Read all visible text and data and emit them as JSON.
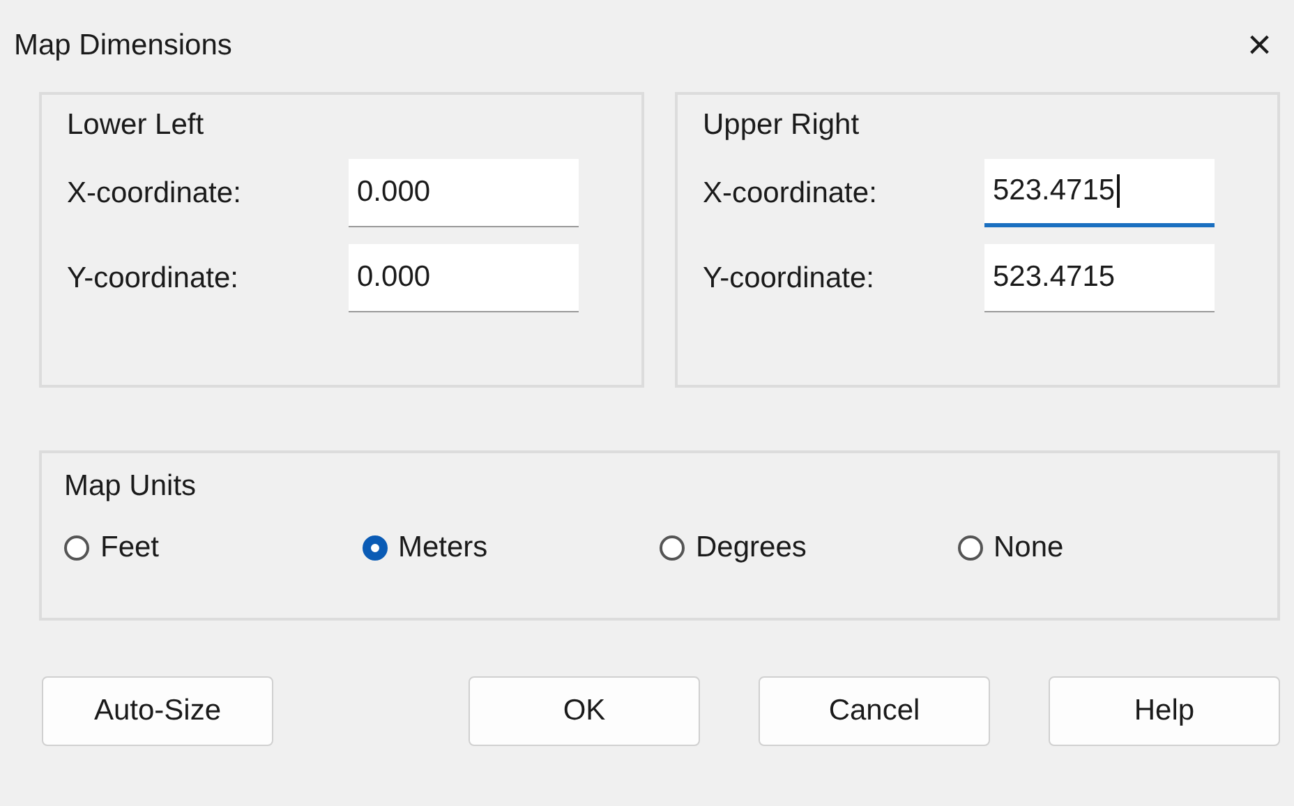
{
  "window": {
    "title": "Map Dimensions",
    "close": "×"
  },
  "groups": [
    {
      "title": "Lower Left",
      "fields": [
        {
          "label": "X-coordinate:",
          "value": "0.000",
          "focused": false
        },
        {
          "label": "Y-coordinate:",
          "value": "0.000",
          "focused": false
        }
      ]
    },
    {
      "title": "Upper Right",
      "fields": [
        {
          "label": "X-coordinate:",
          "value": "523.4715",
          "focused": true
        },
        {
          "label": "Y-coordinate:",
          "value": "523.4715",
          "focused": false
        }
      ]
    }
  ],
  "map_units": {
    "title": "Map Units",
    "options": [
      {
        "label": "Feet",
        "selected": false
      },
      {
        "label": "Meters",
        "selected": true
      },
      {
        "label": "Degrees",
        "selected": false
      },
      {
        "label": "None",
        "selected": false
      }
    ]
  },
  "buttons": [
    "Auto-Size",
    "OK",
    "Cancel",
    "Help"
  ]
}
